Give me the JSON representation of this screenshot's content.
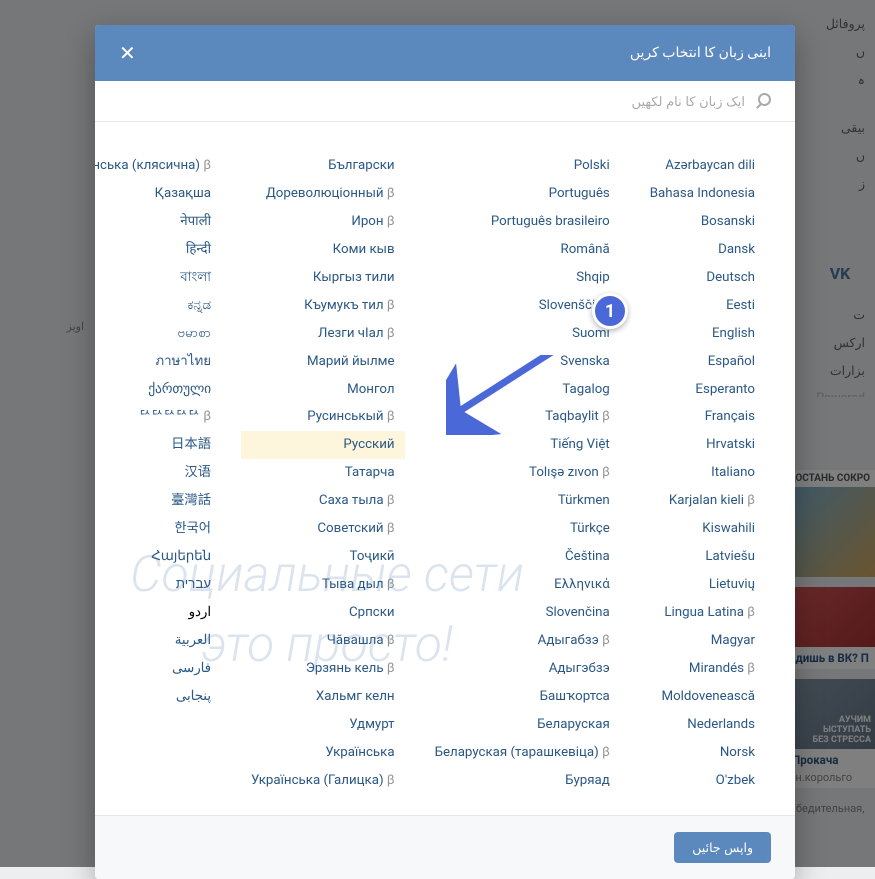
{
  "header_title": "اینی زبان کا انتخاب کریں",
  "search_placeholder": "ایک زبان کا نام لکھیں",
  "back_button": "واپس جائیں",
  "marker_num": "1",
  "watermark_line1": "Социальные сети",
  "watermark_line2": "это просто!",
  "sidebar": {
    "profile": "پروفائل",
    "i1": "ں",
    "i2": "ہ",
    "i3": "بیقی",
    "i4": "ں",
    "i5": "ز",
    "vk": "VK",
    "i6": "ت",
    "i7": "ارکس",
    "i8": "بزارات",
    "powered": "Powered"
  },
  "left_bg": "اویز",
  "ads": {
    "a1_title": "ДОСТАНЬ СОКРО",
    "a2_title": "идишь в ВК? П",
    "a3_title": "АУЧИМ\nЫСТУПАТЬ\nБЕЗ СТРЕССА",
    "a3_caption": "!Прокача",
    "a3_sub": "нн.корольго",
    "a4": "Убедительная, о"
  },
  "cols": [
    [
      "Azərbaycan dili",
      "Bahasa Indonesia",
      "Bosanski",
      "Dansk",
      "Deutsch",
      "Eesti",
      "English",
      "Español",
      "Esperanto",
      "Français",
      "Hrvatski",
      "Italiano",
      "Karjalan kieli β",
      "Kiswahili",
      "Latviešu",
      "Lietuvių",
      "Lingua Latina β",
      "Magyar",
      "Mirandés β",
      "Moldovenească",
      "Nederlands",
      "Norsk",
      "O'zbek"
    ],
    [
      "Polski",
      "Português",
      "Português brasileiro",
      "Română",
      "Shqip",
      "Slovenščina",
      "Suomi",
      "Svenska",
      "Tagalog",
      "Taqbaylit β",
      "Tiếng Việt",
      "Tolışə zıvon β",
      "Türkmen",
      "Türkçe",
      "Čeština",
      "Ελληνικά",
      "Slovenčina",
      "Адыгабзэ β",
      "Адыгэбзэ",
      "Башҡортса",
      "Беларуская",
      "Беларуская (тарашкевіца) β",
      "Буряад"
    ],
    [
      "Български",
      "Дореволюціонный β",
      "Ирон β",
      "Коми кыв",
      "Кыргыз тили",
      "Къумукъ тил β",
      "Лезги чӏал β",
      "Марий йылме",
      "Монгол",
      "Русинськый β",
      "Русский",
      "Татарча",
      "Саха тыла β",
      "Советский β",
      "Тоҷикӣ",
      "Тыва дыл β",
      "Српски",
      "Чӑвашла β",
      "Эрзянь кель β",
      "Хальмг келн",
      "Удмурт",
      "Українська",
      "Українська (Галицка) β"
    ],
    [
      "Українська (клясична) β",
      "Қазақша",
      "नेपाली",
      "हिन्दी",
      "বাংলা",
      "ಕನ್ನಡ",
      "ဗမာစာ",
      "ภาษาไทย",
      "ქართული",
      "ꥢꥢꥢꥢꥢ β",
      "日本語",
      "汉语",
      "臺灣話",
      "한국어",
      "Հայերեն",
      "עברית",
      "اردو",
      "العربية",
      "فارسی",
      "پنجابی"
    ]
  ],
  "highlighted_index": {
    "col": 2,
    "row": 10
  },
  "bold_index": {
    "col": 3,
    "row": 16
  }
}
